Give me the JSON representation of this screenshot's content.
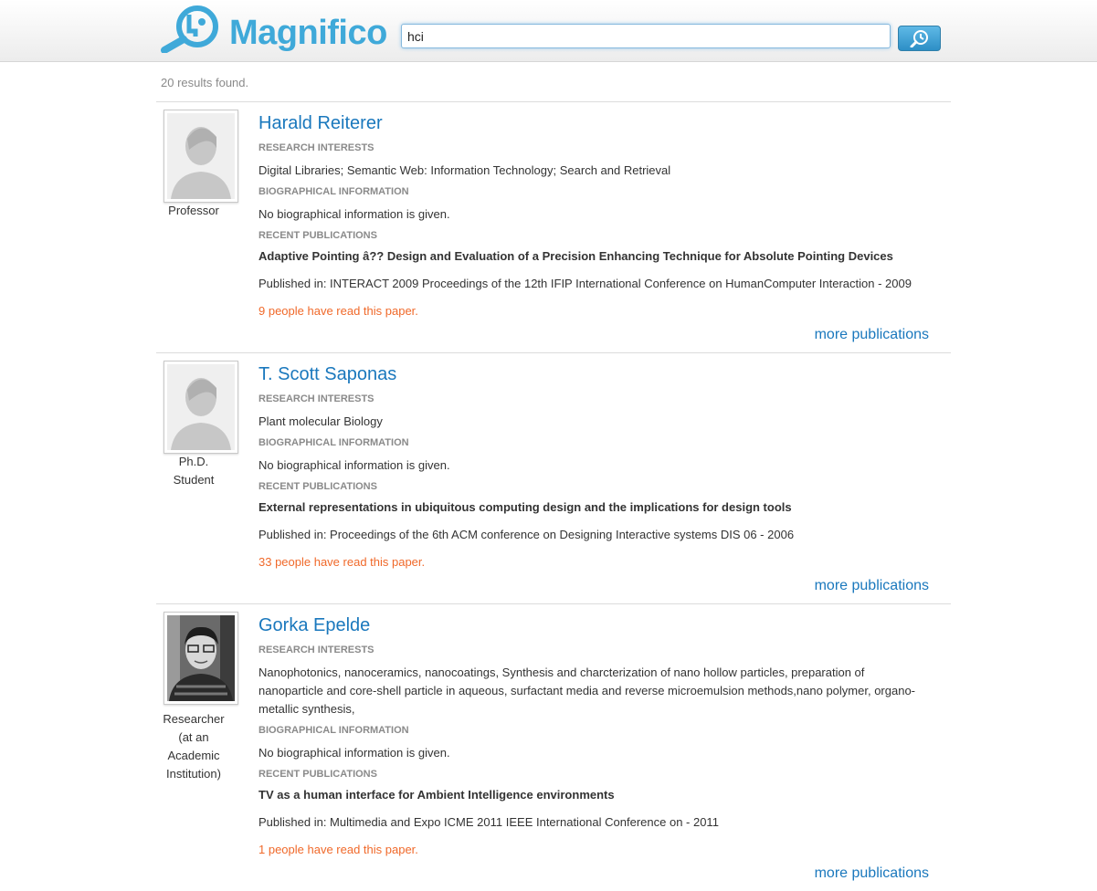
{
  "brand": {
    "name": "Magnifico",
    "logo_color": "#3fa9d9"
  },
  "search": {
    "value": "hci",
    "button_icon": "search-clock-icon"
  },
  "results_count": "20 results found.",
  "labels": {
    "research_interests": "RESEARCH INTERESTS",
    "biographical_information": "BIOGRAPHICAL INFORMATION",
    "recent_publications": "RECENT PUBLICATIONS",
    "more_publications": "more publications"
  },
  "colors": {
    "link": "#1a78bd",
    "readers": "#f0692a",
    "label": "#8a8a8a"
  },
  "results": [
    {
      "name": "Harald Reiterer",
      "role": "Professor",
      "photo": "placeholder-silhouette",
      "research_interests": "Digital Libraries; Semantic Web: Information Technology; Search and Retrieval",
      "bio": "No biographical information is given.",
      "publication_title": "Adaptive Pointing â?? Design and Evaluation of a Precision Enhancing Technique for Absolute Pointing Devices",
      "publication_venue": "Published in: INTERACT 2009 Proceedings of the 12th IFIP International Conference on HumanComputer Interaction - 2009",
      "readers": "9 people have read this paper."
    },
    {
      "name": "T. Scott Saponas",
      "role": "Ph.D. Student",
      "photo": "placeholder-silhouette",
      "research_interests": "Plant molecular Biology",
      "bio": "No biographical information is given.",
      "publication_title": "External representations in ubiquitous computing design and the implications for design tools",
      "publication_venue": "Published in: Proceedings of the 6th ACM conference on Designing Interactive systems DIS 06 - 2006",
      "readers": "33 people have read this paper."
    },
    {
      "name": "Gorka Epelde",
      "role": "Researcher (at an Academic Institution)",
      "photo": "person-photo",
      "research_interests": "Nanophotonics, nanoceramics, nanocoatings, Synthesis and charcterization of nano hollow particles, preparation of nanoparticle and core-shell particle in aqueous, surfactant media and reverse microemulsion methods,nano polymer, organo-metallic synthesis,",
      "bio": "No biographical information is given.",
      "publication_title": "TV as a human interface for Ambient Intelligence environments",
      "publication_venue": "Published in: Multimedia and Expo ICME 2011 IEEE International Conference on - 2011",
      "readers": "1 people have read this paper."
    }
  ]
}
